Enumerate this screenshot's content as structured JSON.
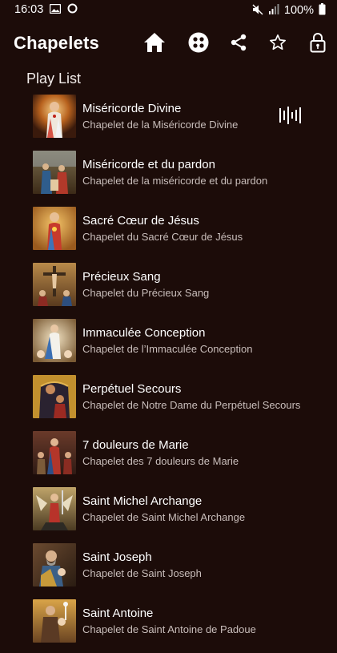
{
  "status": {
    "time": "16:03",
    "battery": "100%"
  },
  "app": {
    "title": "Chapelets"
  },
  "icons": {
    "home": "home-icon",
    "grid": "apps-grid-icon",
    "share": "share-icon",
    "favorite": "star-icon",
    "lock": "lock-icon",
    "playing": "equalizer-icon"
  },
  "section": {
    "title": "Play List"
  },
  "items": [
    {
      "title": "Miséricorde Divine",
      "subtitle": "Chapelet de la Miséricorde Divine"
    },
    {
      "title": "Miséricorde et du pardon",
      "subtitle": "Chapelet de la miséricorde et du pardon"
    },
    {
      "title": "Sacré Cœur de Jésus",
      "subtitle": "Chapelet du Sacré Cœur de Jésus"
    },
    {
      "title": "Précieux Sang",
      "subtitle": "Chapelet du Précieux Sang"
    },
    {
      "title": "Immaculée Conception",
      "subtitle": "Chapelet de l’Immaculée Conception"
    },
    {
      "title": "Perpétuel Secours",
      "subtitle": "Chapelet de Notre Dame du Perpétuel Secours"
    },
    {
      "title": "7 douleurs de Marie",
      "subtitle": "Chapelet des 7 douleurs de Marie"
    },
    {
      "title": "Saint Michel Archange",
      "subtitle": "Chapelet de Saint Michel Archange"
    },
    {
      "title": "Saint Joseph",
      "subtitle": "Chapelet de Saint Joseph"
    },
    {
      "title": "Saint Antoine",
      "subtitle": "Chapelet de Saint Antoine de Padoue"
    }
  ]
}
